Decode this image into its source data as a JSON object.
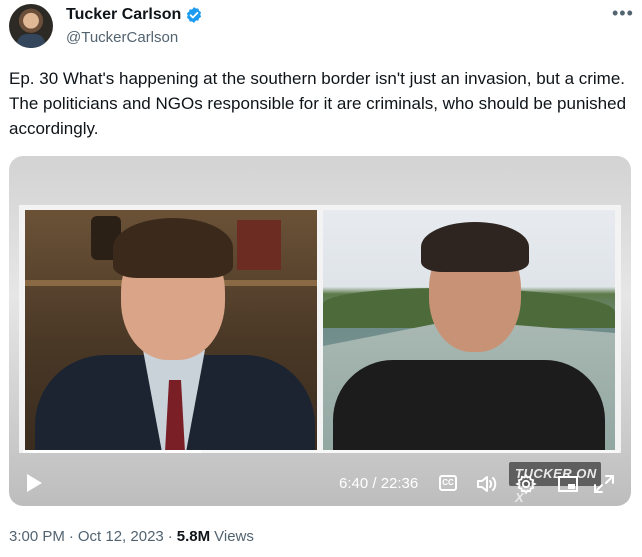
{
  "author": {
    "display_name": "Tucker Carlson",
    "handle": "@TuckerCarlson",
    "verified_color": "#1d9bf0"
  },
  "tweet": {
    "text": "Ep. 30  What's happening at the southern border isn't just an invasion, but a crime. The politicians and NGOs responsible for it are criminals, who should be punished accordingly."
  },
  "video": {
    "time_display": "6:40 / 22:36",
    "progress_fraction": 0.298,
    "cc_label": "CC",
    "watermark": "TUCKER ON X"
  },
  "meta": {
    "time": "3:00 PM",
    "separator": "·",
    "date": "Oct 12, 2023",
    "views_count": "5.8M",
    "views_label": "Views"
  },
  "icons": [
    "verified-badge-icon",
    "more-icon",
    "play-icon",
    "closed-captions-icon",
    "volume-icon",
    "settings-icon",
    "picture-in-picture-icon",
    "fullscreen-icon"
  ]
}
